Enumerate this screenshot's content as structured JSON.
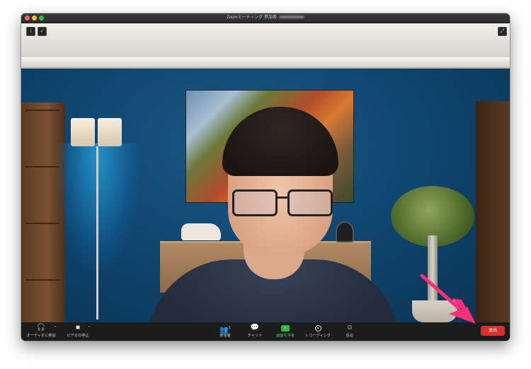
{
  "window": {
    "title": "Zoomミーティング 参加者",
    "title_redacted_name": ""
  },
  "top_controls": {
    "info_icon": "info-icon",
    "shield_icon": "shield-icon",
    "fullscreen_icon": "fullscreen-icon"
  },
  "toolbar": {
    "audio": {
      "label": "オーディオに参加",
      "icon": "headphones-icon"
    },
    "video": {
      "label": "ビデオの停止",
      "icon": "video-camera-icon"
    },
    "participants": {
      "label": "参加者",
      "count": "1",
      "icon": "participants-icon"
    },
    "chat": {
      "label": "チャット",
      "icon": "chat-icon"
    },
    "share": {
      "label": "画面を共有",
      "icon": "share-screen-icon"
    },
    "record": {
      "label": "レコーディング",
      "icon": "record-icon"
    },
    "reactions": {
      "label": "反応",
      "icon": "reaction-icon"
    },
    "leave": {
      "label": "退出"
    }
  },
  "colors": {
    "leave_button": "#d9302c",
    "share_green": "#33b449",
    "annotation_arrow": "#ff2d7a"
  }
}
